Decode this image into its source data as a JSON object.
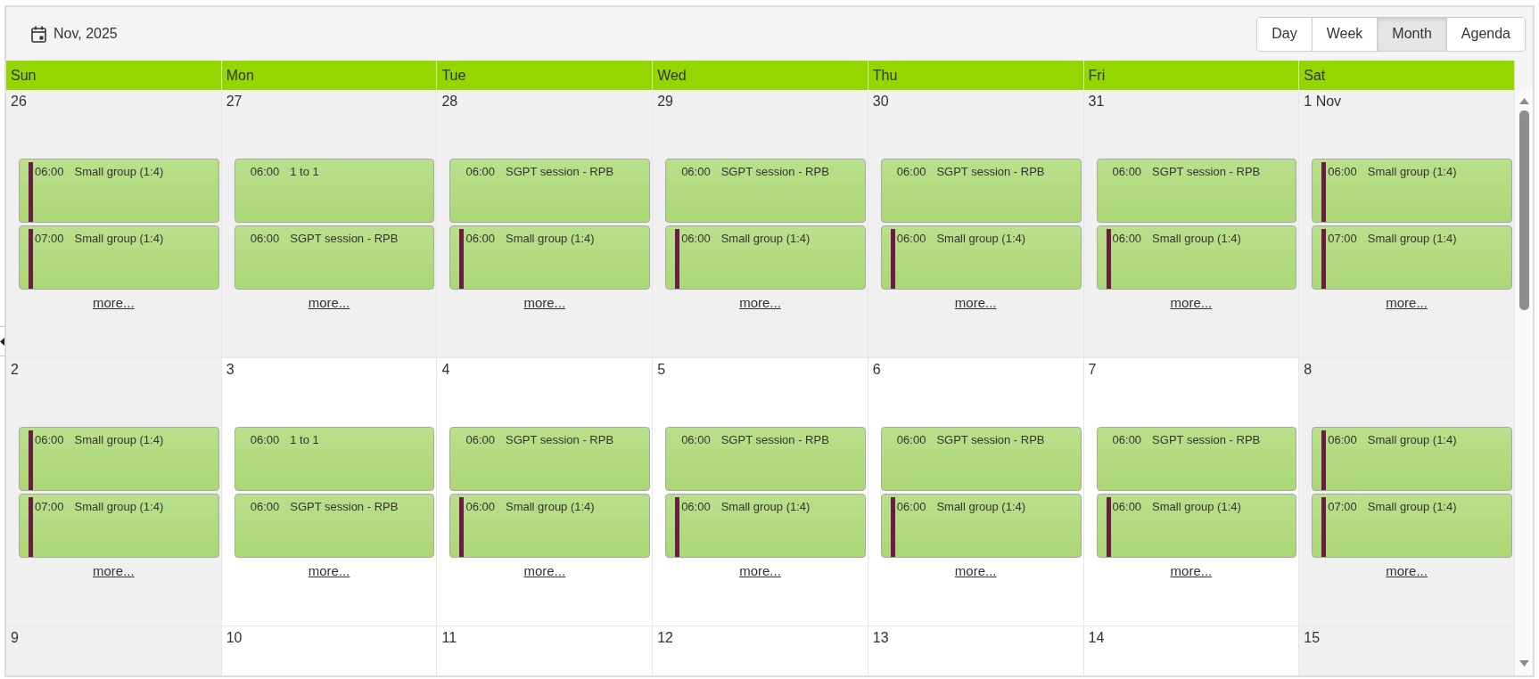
{
  "toolbar": {
    "title": "Nov, 2025",
    "views": [
      {
        "label": "Day",
        "selected": false
      },
      {
        "label": "Week",
        "selected": false
      },
      {
        "label": "Month",
        "selected": true
      },
      {
        "label": "Agenda",
        "selected": false
      }
    ]
  },
  "weekdays": [
    "Sun",
    "Mon",
    "Tue",
    "Wed",
    "Thu",
    "Fri",
    "Sat"
  ],
  "weeks": [
    {
      "days": [
        {
          "date": "26",
          "shaded": true,
          "events": [
            {
              "time": "06:00",
              "title": "Small group (1:4)",
              "flagged": true
            },
            {
              "time": "07:00",
              "title": "Small group (1:4)",
              "flagged": true
            }
          ],
          "more": "more..."
        },
        {
          "date": "27",
          "shaded": true,
          "events": [
            {
              "time": "06:00",
              "title": "1 to 1",
              "flagged": false
            },
            {
              "time": "06:00",
              "title": "SGPT session - RPB",
              "flagged": false
            }
          ],
          "more": "more..."
        },
        {
          "date": "28",
          "shaded": true,
          "events": [
            {
              "time": "06:00",
              "title": "SGPT session - RPB",
              "flagged": false
            },
            {
              "time": "06:00",
              "title": "Small group (1:4)",
              "flagged": true
            }
          ],
          "more": "more..."
        },
        {
          "date": "29",
          "shaded": true,
          "events": [
            {
              "time": "06:00",
              "title": "SGPT session - RPB",
              "flagged": false
            },
            {
              "time": "06:00",
              "title": "Small group (1:4)",
              "flagged": true
            }
          ],
          "more": "more..."
        },
        {
          "date": "30",
          "shaded": true,
          "events": [
            {
              "time": "06:00",
              "title": "SGPT session - RPB",
              "flagged": false
            },
            {
              "time": "06:00",
              "title": "Small group (1:4)",
              "flagged": true
            }
          ],
          "more": "more..."
        },
        {
          "date": "31",
          "shaded": true,
          "events": [
            {
              "time": "06:00",
              "title": "SGPT session - RPB",
              "flagged": false
            },
            {
              "time": "06:00",
              "title": "Small group (1:4)",
              "flagged": true
            }
          ],
          "more": "more..."
        },
        {
          "date": "1 Nov",
          "shaded": true,
          "events": [
            {
              "time": "06:00",
              "title": "Small group (1:4)",
              "flagged": true
            },
            {
              "time": "07:00",
              "title": "Small group (1:4)",
              "flagged": true
            }
          ],
          "more": "more..."
        }
      ]
    },
    {
      "days": [
        {
          "date": "2",
          "shaded": true,
          "events": [
            {
              "time": "06:00",
              "title": "Small group (1:4)",
              "flagged": true
            },
            {
              "time": "07:00",
              "title": "Small group (1:4)",
              "flagged": true
            }
          ],
          "more": "more..."
        },
        {
          "date": "3",
          "shaded": false,
          "events": [
            {
              "time": "06:00",
              "title": "1 to 1",
              "flagged": false
            },
            {
              "time": "06:00",
              "title": "SGPT session - RPB",
              "flagged": false
            }
          ],
          "more": "more..."
        },
        {
          "date": "4",
          "shaded": false,
          "events": [
            {
              "time": "06:00",
              "title": "SGPT session - RPB",
              "flagged": false
            },
            {
              "time": "06:00",
              "title": "Small group (1:4)",
              "flagged": true
            }
          ],
          "more": "more..."
        },
        {
          "date": "5",
          "shaded": false,
          "events": [
            {
              "time": "06:00",
              "title": "SGPT session - RPB",
              "flagged": false
            },
            {
              "time": "06:00",
              "title": "Small group (1:4)",
              "flagged": true
            }
          ],
          "more": "more..."
        },
        {
          "date": "6",
          "shaded": false,
          "events": [
            {
              "time": "06:00",
              "title": "SGPT session - RPB",
              "flagged": false
            },
            {
              "time": "06:00",
              "title": "Small group (1:4)",
              "flagged": true
            }
          ],
          "more": "more..."
        },
        {
          "date": "7",
          "shaded": false,
          "events": [
            {
              "time": "06:00",
              "title": "SGPT session - RPB",
              "flagged": false
            },
            {
              "time": "06:00",
              "title": "Small group (1:4)",
              "flagged": true
            }
          ],
          "more": "more..."
        },
        {
          "date": "8",
          "shaded": true,
          "events": [
            {
              "time": "06:00",
              "title": "Small group (1:4)",
              "flagged": true
            },
            {
              "time": "07:00",
              "title": "Small group (1:4)",
              "flagged": true
            }
          ],
          "more": "more..."
        }
      ]
    },
    {
      "days": [
        {
          "date": "9",
          "shaded": true
        },
        {
          "date": "10",
          "shaded": false
        },
        {
          "date": "11",
          "shaded": false
        },
        {
          "date": "12",
          "shaded": false
        },
        {
          "date": "13",
          "shaded": false
        },
        {
          "date": "14",
          "shaded": false
        },
        {
          "date": "15",
          "shaded": true
        }
      ]
    }
  ]
}
